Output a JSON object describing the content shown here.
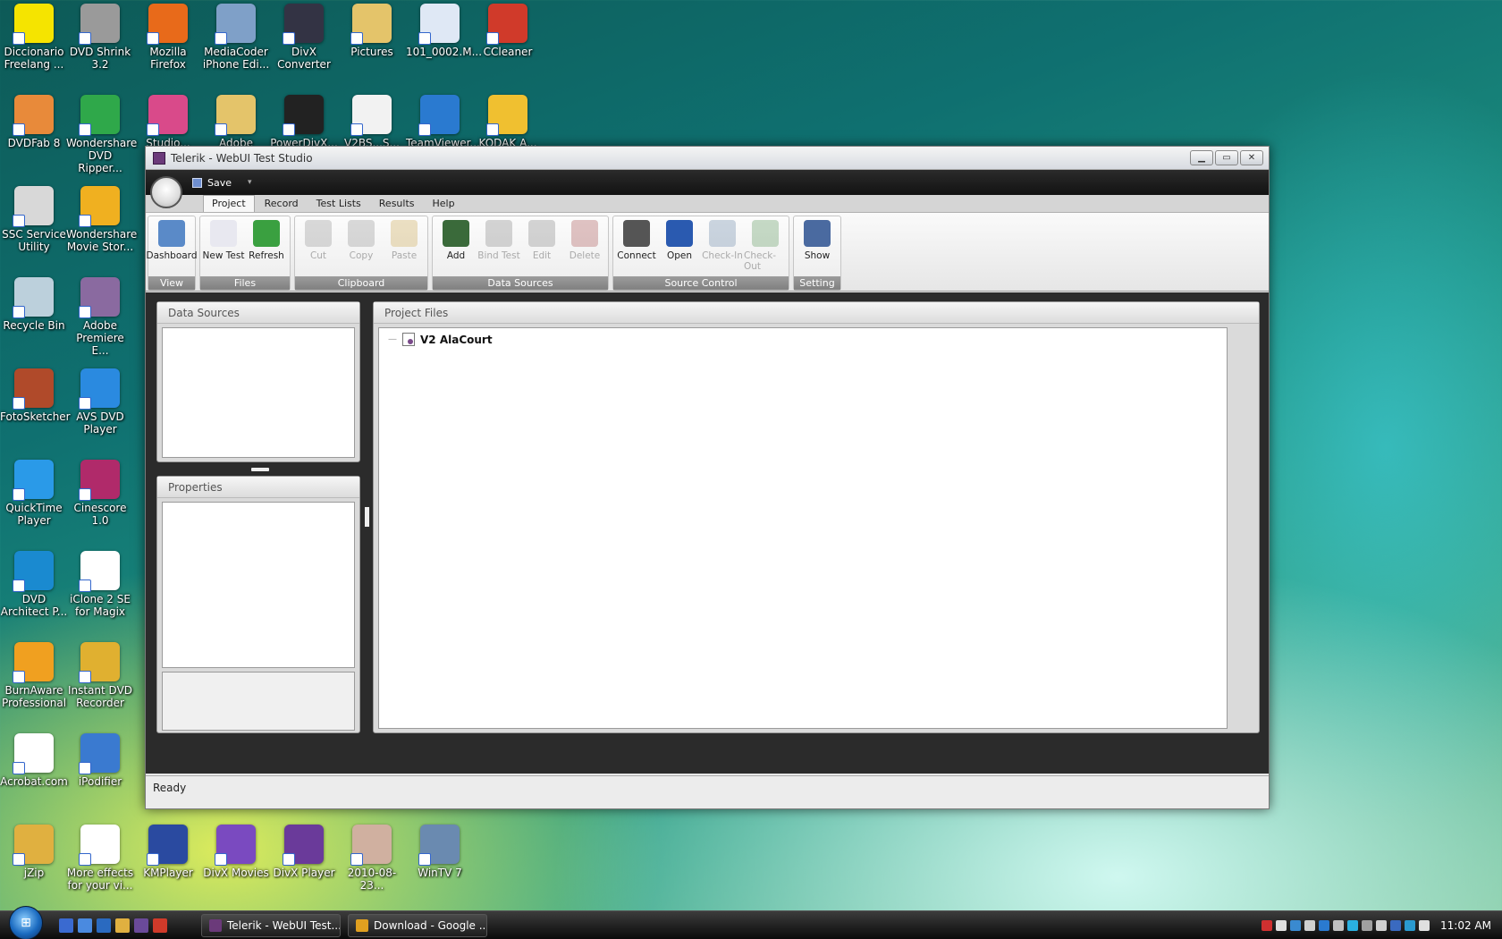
{
  "desktop": {
    "icons": [
      {
        "label": "Diccionario Freelang ...",
        "color": "#f5e400"
      },
      {
        "label": "DVD Shrink 3.2",
        "color": "#9a9a9a"
      },
      {
        "label": "Mozilla Firefox",
        "color": "#e86a1a"
      },
      {
        "label": "MediaCoder iPhone Edi...",
        "color": "#7fa0c8"
      },
      {
        "label": "DivX Converter",
        "color": "#333344"
      },
      {
        "label": "Pictures",
        "color": "#e4c46a"
      },
      {
        "label": "101_0002.M...",
        "color": "#dfe8f5"
      },
      {
        "label": "CCleaner",
        "color": "#d03a2a"
      },
      {
        "label": "DVDFab 8",
        "color": "#e88a3a"
      },
      {
        "label": "Wondershare DVD Ripper...",
        "color": "#2fa84a"
      },
      {
        "label": "Studio...",
        "color": "#d94a8a"
      },
      {
        "label": "Adobe CS4...",
        "color": "#e4c46a"
      },
      {
        "label": "PowerDivX...",
        "color": "#222222"
      },
      {
        "label": "V2BS...S...",
        "color": "#f2f2f2"
      },
      {
        "label": "TeamViewer...",
        "color": "#2a7ad0"
      },
      {
        "label": "KODAK A...",
        "color": "#f0c030"
      },
      {
        "label": "SSC Service Utility",
        "color": "#d8d8d8"
      },
      {
        "label": "Wondershare Movie Stor...",
        "color": "#f0b020"
      },
      {
        "label": "Recycle Bin",
        "color": "#bcd0dc"
      },
      {
        "label": "Adobe Premiere E...",
        "color": "#8a6aa0"
      },
      {
        "label": "FotoSketcher",
        "color": "#b04a2a"
      },
      {
        "label": "AVS DVD Player",
        "color": "#2a8ae0"
      },
      {
        "label": "QuickTime Player",
        "color": "#2a9ae8"
      },
      {
        "label": "Cinescore 1.0",
        "color": "#b02a6a"
      },
      {
        "label": "DVD Architect P...",
        "color": "#1a8ad0"
      },
      {
        "label": "iClone 2 SE for Magix",
        "color": "#ffffff"
      },
      {
        "label": "BurnAware Professional",
        "color": "#f0a020"
      },
      {
        "label": "Instant DVD Recorder",
        "color": "#e0b030"
      },
      {
        "label": "Acrobat.com",
        "color": "#ffffff"
      },
      {
        "label": "iPodifier",
        "color": "#3a7ad0"
      },
      {
        "label": "jZip",
        "color": "#e0b040"
      },
      {
        "label": "More effects for your vi...",
        "color": "#ffffff"
      },
      {
        "label": "KMPlayer",
        "color": "#2a4aa0"
      },
      {
        "label": "DivX Movies",
        "color": "#7a4ac0"
      },
      {
        "label": "DivX Player",
        "color": "#6a3a9a"
      },
      {
        "label": "2010-08-23...",
        "color": "#d0b0a0"
      },
      {
        "label": "WinTV 7",
        "color": "#6a8ab0"
      }
    ]
  },
  "window": {
    "title": "Telerik - WebUI Test Studio",
    "buttons": {
      "minimize": "▁",
      "maximize": "▭",
      "close": "✕"
    },
    "quick_access": {
      "save_label": "Save",
      "dropdown": "▾"
    },
    "tabs": [
      "Project",
      "Record",
      "Test Lists",
      "Results",
      "Help"
    ],
    "ribbon": {
      "groups": [
        {
          "label": "View",
          "buttons": [
            {
              "label": "Dashboard",
              "color": "#5a8ac8",
              "disabled": false
            }
          ]
        },
        {
          "label": "Files",
          "buttons": [
            {
              "label": "New Test",
              "color": "#e8e8f0",
              "disabled": false
            },
            {
              "label": "Refresh",
              "color": "#3aa040",
              "disabled": false
            }
          ]
        },
        {
          "label": "Clipboard",
          "buttons": [
            {
              "label": "Cut",
              "color": "#888888",
              "disabled": true
            },
            {
              "label": "Copy",
              "color": "#888888",
              "disabled": true
            },
            {
              "label": "Paste",
              "color": "#c8a040",
              "disabled": true
            }
          ]
        },
        {
          "label": "Data Sources",
          "buttons": [
            {
              "label": "Add",
              "color": "#3a6a3a",
              "disabled": false
            },
            {
              "label": "Bind Test",
              "color": "#777777",
              "disabled": true
            },
            {
              "label": "Edit",
              "color": "#777777",
              "disabled": true
            },
            {
              "label": "Delete",
              "color": "#a04040",
              "disabled": true
            }
          ]
        },
        {
          "label": "Source Control",
          "buttons": [
            {
              "label": "Connect",
              "color": "#555555",
              "disabled": false
            },
            {
              "label": "Open",
              "color": "#2a5ab0",
              "disabled": false
            },
            {
              "label": "Check-In",
              "color": "#5a7aa0",
              "disabled": true
            },
            {
              "label": "Check-Out",
              "color": "#4a8a4a",
              "disabled": true
            }
          ]
        },
        {
          "label": "Setting",
          "buttons": [
            {
              "label": "Show",
              "color": "#4a6aa0",
              "disabled": false
            }
          ]
        }
      ]
    },
    "panels": {
      "data_sources": {
        "title": "Data Sources"
      },
      "properties": {
        "title": "Properties"
      },
      "project_files": {
        "title": "Project Files",
        "tree": [
          {
            "label": "V2 AlaCourt",
            "expander": "—"
          }
        ]
      }
    },
    "status": "Ready"
  },
  "taskbar": {
    "start_glyph": "⊞",
    "quicklaunch_colors": [
      "#3a6ad0",
      "#4a8ae0",
      "#2a6ac0",
      "#e0b040",
      "#6a4a9a",
      "#d03a2a"
    ],
    "tasks": [
      {
        "label": "Telerik - WebUI Test...",
        "color": "#6b3a7a"
      },
      {
        "label": "Download - Google ...",
        "color": "#e0a020"
      }
    ],
    "tray_colors": [
      "#d03030",
      "#e0e0e0",
      "#3a8ad0",
      "#d0d0d0",
      "#2a7ad0",
      "#c0c0c0",
      "#2ab0e0",
      "#a0a0a0",
      "#d0d0d0",
      "#3a6ac0",
      "#2a9ad0",
      "#e0e0e0"
    ],
    "clock": "11:02 AM"
  }
}
